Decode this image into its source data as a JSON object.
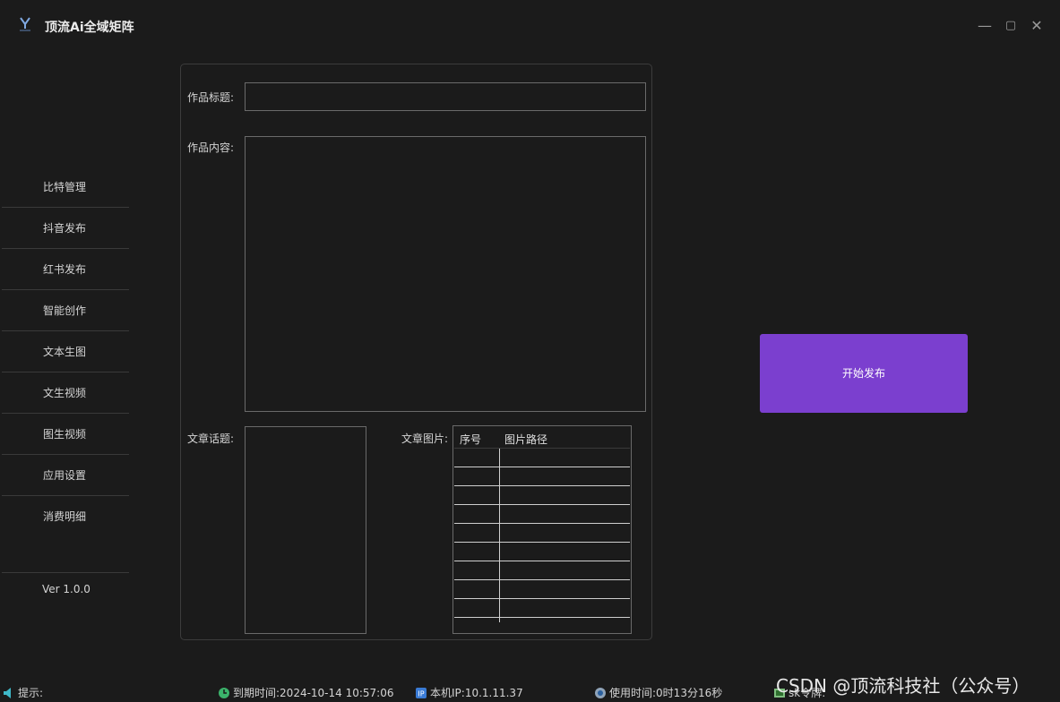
{
  "app": {
    "title": "顶流Ai全域矩阵"
  },
  "window_controls": {
    "minimize": "—",
    "maximize": "▢",
    "close": "✕"
  },
  "sidebar": {
    "items": [
      {
        "label": "比特管理"
      },
      {
        "label": "抖音发布"
      },
      {
        "label": "红书发布"
      },
      {
        "label": "智能创作"
      },
      {
        "label": "文本生图"
      },
      {
        "label": "文生视频"
      },
      {
        "label": "图生视频"
      },
      {
        "label": "应用设置"
      },
      {
        "label": "消费明细"
      }
    ],
    "version": "Ver 1.0.0"
  },
  "form": {
    "title_label": "作品标题:",
    "title_value": "",
    "content_label": "作品内容:",
    "content_value": "",
    "topic_label": "文章话题:",
    "image_label": "文章图片:",
    "image_table": {
      "columns": [
        "序号",
        "图片路径"
      ],
      "rows": []
    }
  },
  "actions": {
    "publish_label": "开始发布"
  },
  "status_bar": {
    "hint": "提示:",
    "expire": "到期时间:2024-10-14 10:57:06",
    "ip": "本机IP:10.1.11.37",
    "usage": "使用时间:0时13分16秒",
    "sk": "sk令牌:"
  },
  "watermark": "CSDN @顶流科技社（公众号）",
  "colors": {
    "accent": "#7b3fcf",
    "background": "#1b1b1b",
    "border": "#6a6a6a"
  }
}
